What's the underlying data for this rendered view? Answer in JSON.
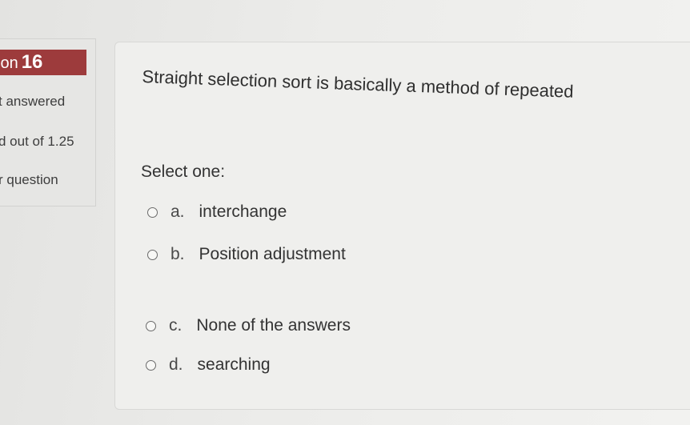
{
  "info": {
    "question_prefix": "ion",
    "question_number": "16",
    "status": "t answered",
    "marks": "d out of 1.25",
    "flag": "r question"
  },
  "question": {
    "text": "Straight selection sort is basically a method of repeated",
    "instruction": "Select one:",
    "options": [
      {
        "letter": "a.",
        "label": "interchange"
      },
      {
        "letter": "b.",
        "label": "Position adjustment"
      },
      {
        "letter": "c.",
        "label": "None of the answers"
      },
      {
        "letter": "d.",
        "label": "searching"
      }
    ]
  }
}
